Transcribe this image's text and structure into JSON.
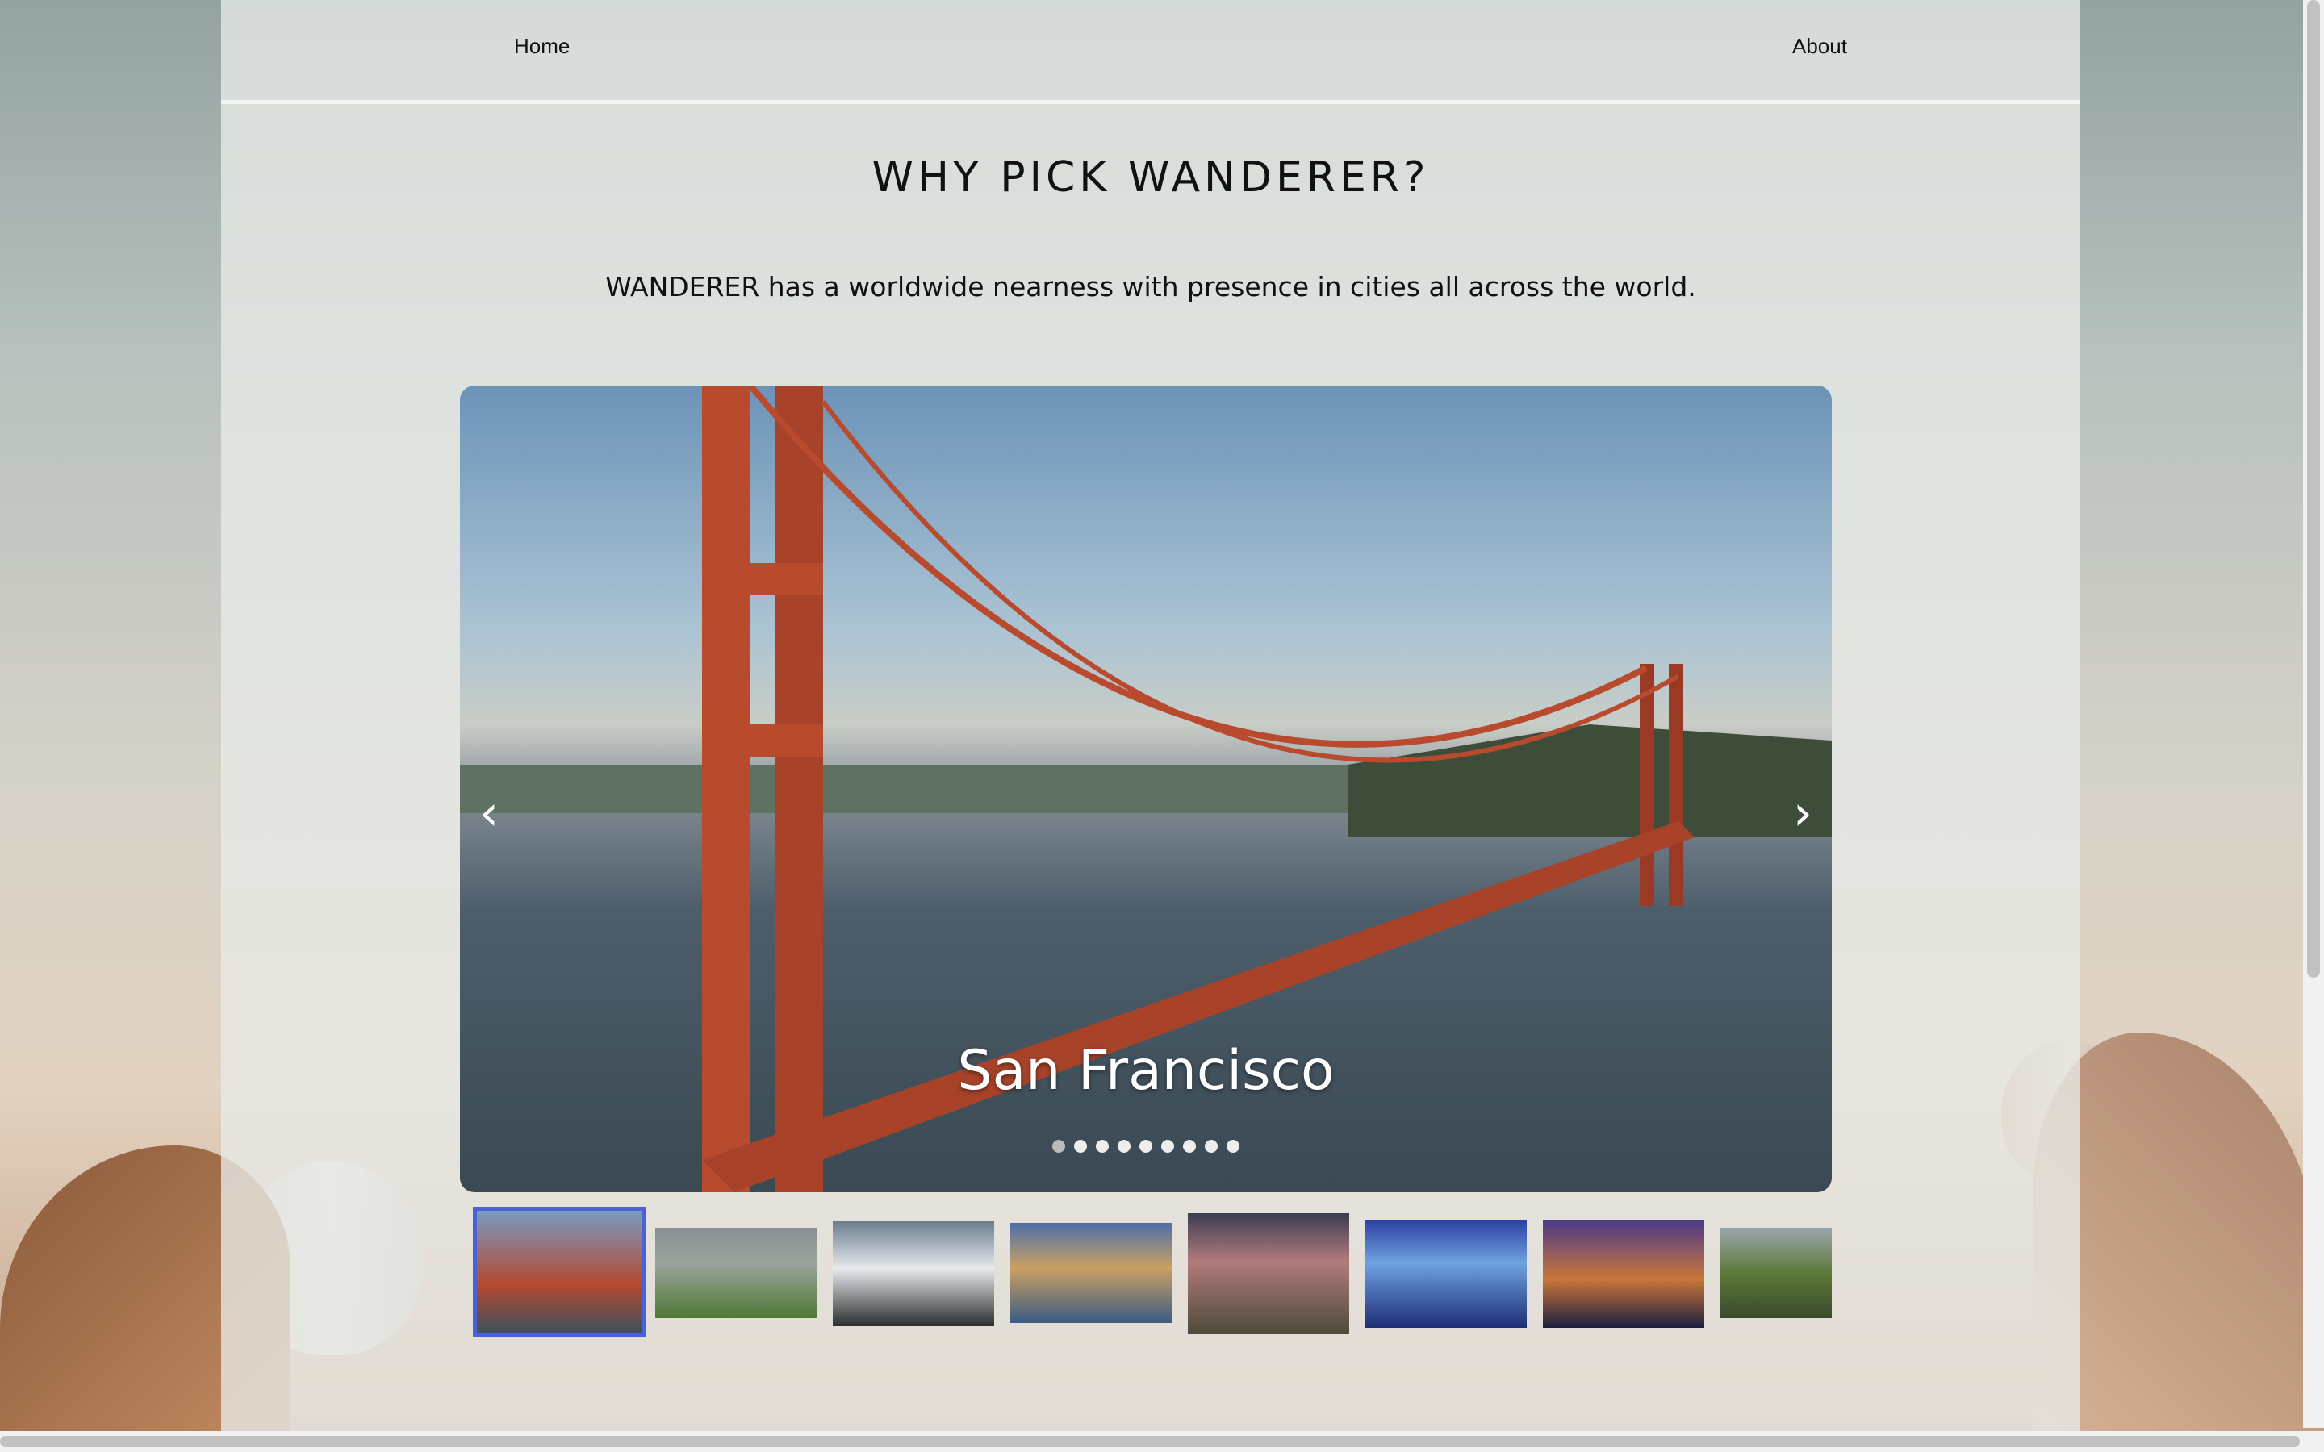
{
  "nav": {
    "home_label": "Home",
    "about_label": "About"
  },
  "heading": {
    "title": "WHY PICK WANDERER?",
    "subtitle": "WANDERER has a worldwide nearness with presence in cities all across the world."
  },
  "carousel": {
    "caption": "San Francisco",
    "prev_glyph": "‹",
    "next_glyph": "›",
    "slide_count": 9,
    "active_index": 0,
    "thumbnails": [
      "golden-gate-bridge",
      "green-hills-rock",
      "snowy-mountain",
      "palace-of-fine-arts",
      "standing-stones-sunset",
      "blue-mountains-fog",
      "bay-bridge-night",
      "river-village"
    ]
  },
  "colors": {
    "selected_thumb_border": "#4a62d8"
  }
}
